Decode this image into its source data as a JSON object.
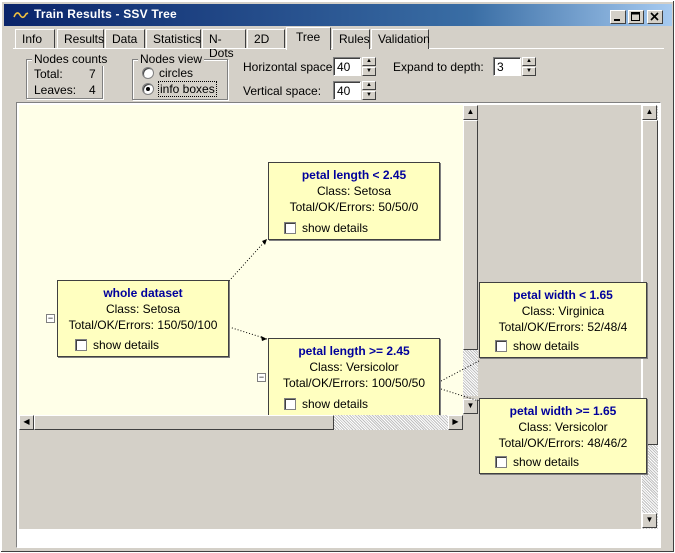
{
  "window": {
    "title": "Train Results - SSV Tree"
  },
  "tabs": [
    {
      "label": "Info",
      "active": false
    },
    {
      "label": "Results",
      "active": false
    },
    {
      "label": "Data",
      "active": false
    },
    {
      "label": "Statistics",
      "active": false
    },
    {
      "label": "N-Dots",
      "active": false
    },
    {
      "label": "2D",
      "active": false
    },
    {
      "label": "Tree",
      "active": true
    },
    {
      "label": "Rules",
      "active": false
    },
    {
      "label": "Validation",
      "active": false
    }
  ],
  "nodes_counts": {
    "title": "Nodes counts",
    "total_label": "Total:",
    "total_value": "7",
    "leaves_label": "Leaves:",
    "leaves_value": "4"
  },
  "nodes_view": {
    "title": "Nodes view",
    "options": [
      {
        "label": "circles",
        "selected": false
      },
      {
        "label": "info boxes",
        "selected": true
      }
    ]
  },
  "spacing": {
    "horizontal_label": "Horizontal space:",
    "horizontal_value": "40",
    "vertical_label": "Vertical space:",
    "vertical_value": "40"
  },
  "expand": {
    "label": "Expand to depth:",
    "value": "3"
  },
  "tree_nodes": [
    {
      "title": "whole dataset",
      "class": "Class: Setosa",
      "counts": "Total/OK/Errors: 150/50/100",
      "details_label": "show details",
      "collapse": "−"
    },
    {
      "title": "petal length < 2.45",
      "class": "Class: Setosa",
      "counts": "Total/OK/Errors: 50/50/0",
      "details_label": "show details"
    },
    {
      "title": "petal length >= 2.45",
      "class": "Class: Versicolor",
      "counts": "Total/OK/Errors: 100/50/50",
      "details_label": "show details",
      "collapse": "−"
    },
    {
      "title": "petal width < 1.65",
      "class": "Class: Virginica",
      "counts": "Total/OK/Errors: 52/48/4",
      "details_label": "show details"
    },
    {
      "title": "petal width >= 1.65",
      "class": "Class: Versicolor",
      "counts": "Total/OK/Errors: 48/46/2",
      "details_label": "show details"
    }
  ],
  "colors": {
    "titlebar": "#0a246a",
    "canvas": "#ffffe8",
    "node_bg": "#ffffc0",
    "node_title": "#00009c"
  },
  "icons": {
    "app": "waveform-icon",
    "minimize": "minimize-icon",
    "maximize": "maximize-icon",
    "close": "close-icon"
  }
}
